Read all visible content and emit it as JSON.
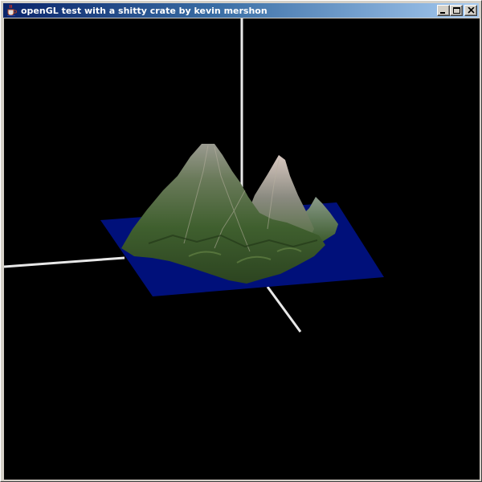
{
  "window": {
    "title": "openGL test with a shitty crate by kevin mershon",
    "controls": [
      "minimize",
      "maximize",
      "close"
    ]
  },
  "scene": {
    "background_color": "#000000",
    "water_color": "#00107a",
    "axis_color": "#e8e8e8",
    "terrain_colors": [
      "#2f4a22",
      "#4a6a36",
      "#7a8a6a",
      "#c8b8a8"
    ]
  },
  "icons": {
    "app": "java-cup-icon",
    "minimize": "minimize-icon",
    "maximize": "maximize-icon",
    "close": "close-icon"
  }
}
